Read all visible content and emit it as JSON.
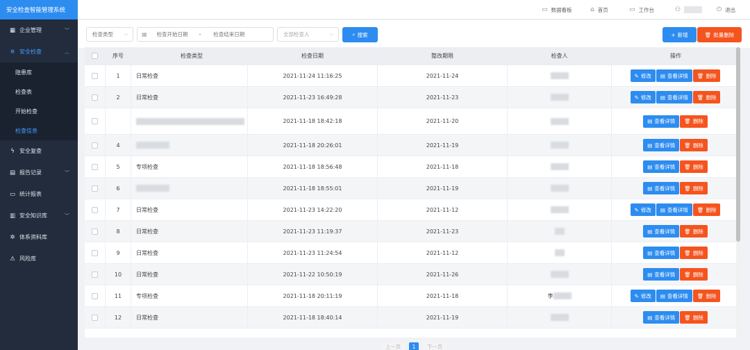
{
  "app": {
    "title": "安全检查智能管理系统"
  },
  "sidebar": {
    "items": [
      {
        "label": "企业管理",
        "icon": "building-icon",
        "glyph": "▦",
        "expandable": true
      },
      {
        "label": "安全检查",
        "icon": "checklist-icon",
        "glyph": "⛯",
        "expandable": true,
        "expanded": true
      },
      {
        "label": "安全复查",
        "icon": "bolt-icon",
        "glyph": "ϟ",
        "expandable": false
      },
      {
        "label": "报告记录",
        "icon": "report-icon",
        "glyph": "▤",
        "expandable": true
      },
      {
        "label": "统计报表",
        "icon": "folder-icon",
        "glyph": "▭",
        "expandable": false
      },
      {
        "label": "安全知识库",
        "icon": "book-icon",
        "glyph": "▥",
        "expandable": true
      },
      {
        "label": "体系资料库",
        "icon": "gear-icon",
        "glyph": "✲",
        "expandable": false
      },
      {
        "label": "风险库",
        "icon": "warning-icon",
        "glyph": "⚠",
        "expandable": false
      }
    ],
    "sub_items": [
      {
        "label": "隐患库"
      },
      {
        "label": "检查表"
      },
      {
        "label": "开始检查"
      },
      {
        "label": "检查信息",
        "active": true
      }
    ]
  },
  "topbar": {
    "dashboard": "数据看板",
    "home": "首页",
    "workbench": "工作台",
    "logout": "退出"
  },
  "filters": {
    "type_placeholder": "检查类型",
    "start_date_placeholder": "检查开始日期",
    "range_separator": "-",
    "end_date_placeholder": "检查结束日期",
    "inspector_placeholder": "全部检查人",
    "search_label": "搜索",
    "add_label": "新增",
    "batch_delete_label": "批量删除"
  },
  "table": {
    "columns": [
      "序号",
      "检查类型",
      "检查日期",
      "整改期限",
      "检查人",
      "操作"
    ],
    "op_labels": {
      "edit": "修改",
      "view": "查看详情",
      "delete": "删除"
    },
    "rows": [
      {
        "index": "1",
        "type": "日常检查",
        "date": "2021-11-24 11:16:25",
        "deadline": "2021-11-24",
        "inspector": "",
        "editable": true
      },
      {
        "index": "2",
        "type": "日常检查",
        "date": "2021-11-23 16:49:28",
        "deadline": "2021-11-23",
        "inspector": "",
        "editable": true
      },
      {
        "index": "",
        "type": "",
        "date": "2021-11-18 18:42:18",
        "deadline": "2021-11-20",
        "inspector": "",
        "editable": false
      },
      {
        "index": "4",
        "type": "",
        "date": "2021-11-18 20:26:01",
        "deadline": "2021-11-19",
        "inspector": "",
        "editable": false
      },
      {
        "index": "5",
        "type": "专项检查",
        "date": "2021-11-18 18:56:48",
        "deadline": "2021-11-18",
        "inspector": "",
        "editable": false
      },
      {
        "index": "6",
        "type": "",
        "date": "2021-11-18 18:55:01",
        "deadline": "2021-11-19",
        "inspector": "",
        "editable": false
      },
      {
        "index": "7",
        "type": "日常检查",
        "date": "2021-11-23 14:22:20",
        "deadline": "2021-11-12",
        "inspector": "",
        "editable": true
      },
      {
        "index": "8",
        "type": "日常检查",
        "date": "2021-11-23 11:19:37",
        "deadline": "2021-11-23",
        "inspector": "",
        "editable": false
      },
      {
        "index": "9",
        "type": "日常检查",
        "date": "2021-11-23 11:24:54",
        "deadline": "2021-11-12",
        "inspector": "",
        "editable": false
      },
      {
        "index": "10",
        "type": "日常检查",
        "date": "2021-11-22 10:50:19",
        "deadline": "2021-11-26",
        "inspector": "",
        "editable": false
      },
      {
        "index": "11",
        "type": "专项检查",
        "date": "2021-11-18 20:11:19",
        "deadline": "2021-11-18",
        "inspector": "李",
        "editable": true
      },
      {
        "index": "12",
        "type": "日常检查",
        "date": "2021-11-18 18:40:14",
        "deadline": "2021-11-19",
        "inspector": "",
        "editable": false
      }
    ]
  },
  "pagination": {
    "prev": "上一页",
    "current": "1",
    "next": "下一页"
  }
}
